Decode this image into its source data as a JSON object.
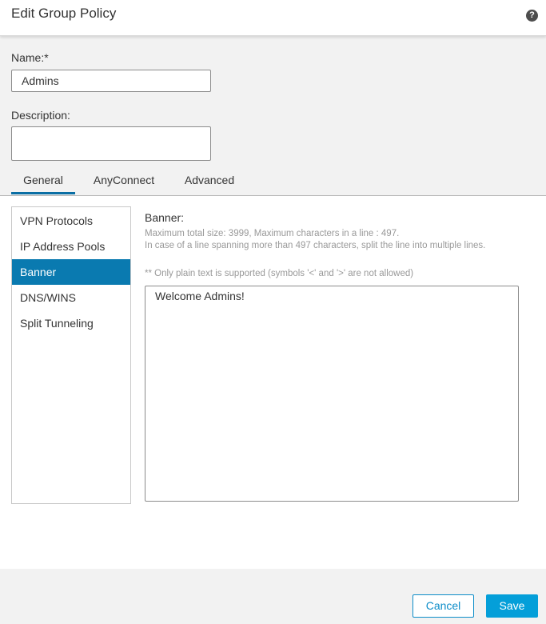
{
  "dialog": {
    "title": "Edit Group Policy",
    "help_icon": "?"
  },
  "form": {
    "name_label": "Name:*",
    "name_value": "Admins",
    "description_label": "Description:",
    "description_value": ""
  },
  "tabs": [
    {
      "label": "General",
      "active": true
    },
    {
      "label": "AnyConnect",
      "active": false
    },
    {
      "label": "Advanced",
      "active": false
    }
  ],
  "nav": {
    "items": [
      {
        "label": "VPN Protocols",
        "selected": false
      },
      {
        "label": "IP Address Pools",
        "selected": false
      },
      {
        "label": "Banner",
        "selected": true
      },
      {
        "label": "DNS/WINS",
        "selected": false
      },
      {
        "label": "Split Tunneling",
        "selected": false
      }
    ]
  },
  "banner": {
    "label": "Banner:",
    "hint_line1": "Maximum total size: 3999, Maximum characters in a line : 497.",
    "hint_line2": "In case of a line spanning more than 497 characters, split the line into multiple lines.",
    "plain_text_note": "** Only plain text is supported (symbols '<' and '>' are not allowed)",
    "value": "Welcome Admins!"
  },
  "footer": {
    "cancel_label": "Cancel",
    "save_label": "Save"
  },
  "colors": {
    "accent": "#049fd9",
    "selected_nav": "#0a7ab0",
    "tab_underline": "#0a6ea4",
    "panel_gray": "#f2f2f2"
  }
}
